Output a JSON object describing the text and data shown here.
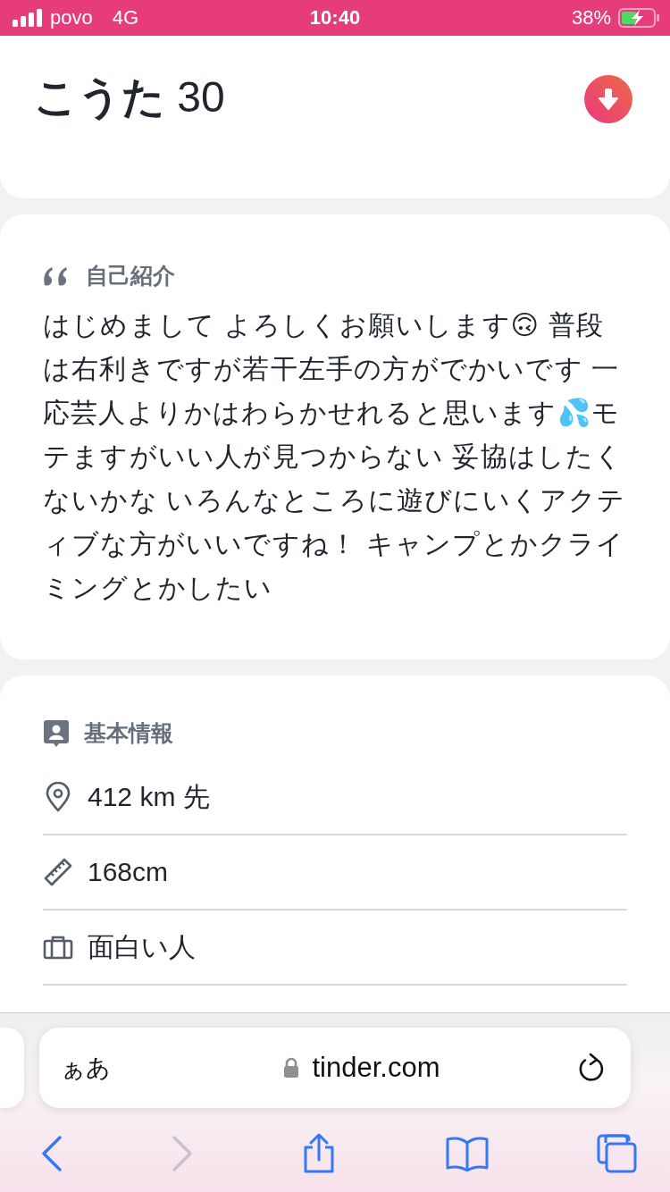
{
  "status_bar": {
    "carrier": "povo",
    "network": "4G",
    "time": "10:40",
    "battery": "38%",
    "charging": true
  },
  "profile": {
    "name": "こうた",
    "age": "30"
  },
  "about": {
    "title": "自己紹介",
    "text": "はじめまして よろしくお願いします🙃 普段は右利きですが若干左手の方がでかいです 一応芸人よりかはわらかせれると思います💦モテますがいい人が見つからない 妥協はしたくないかな いろんなところに遊びにいくアクティブな方がいいですね！ キャンプとかクライミングとかしたい"
  },
  "basic_info": {
    "title": "基本情報",
    "rows": [
      {
        "kind": "distance",
        "text": "412 km 先"
      },
      {
        "kind": "height",
        "text": "168cm"
      },
      {
        "kind": "job",
        "text": "面白い人"
      }
    ]
  },
  "browser": {
    "text_size": "ぁあ",
    "url": "tinder.com",
    "toolbar": [
      {
        "kind": "back",
        "disabled": false
      },
      {
        "kind": "forward",
        "disabled": true
      },
      {
        "kind": "share",
        "disabled": false
      },
      {
        "kind": "bookmarks",
        "disabled": false
      },
      {
        "kind": "tabs",
        "disabled": false
      }
    ]
  }
}
